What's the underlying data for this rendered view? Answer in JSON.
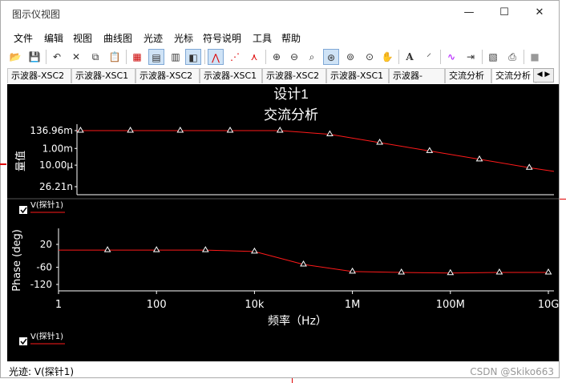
{
  "window": {
    "title": "图示仪视图",
    "controls": [
      "—",
      "☐",
      "✕"
    ]
  },
  "menu": [
    "文件",
    "编辑",
    "视图",
    "曲线图",
    "光迹",
    "光标",
    "符号说明",
    "工具",
    "帮助"
  ],
  "toolbar": {
    "icons": [
      "open-icon",
      "save-icon",
      "undo-icon",
      "cut-icon",
      "copy-icon",
      "paste-icon",
      "grid-icon",
      "legend-icon",
      "bar-icon",
      "overlay-icon",
      "line-icon",
      "dots-icon",
      "line-dots-icon",
      "zoom-in-icon",
      "zoom-out-icon",
      "zoom-fit-icon",
      "zoom-x-icon",
      "zoom-y-icon",
      "zoom-xy-icon",
      "pan-icon",
      "text-icon",
      "marker-icon",
      "trace-icon",
      "export-icon",
      "copy-graph-icon",
      "print-icon",
      "stop-icon"
    ],
    "text_button": "A"
  },
  "tabs": [
    "示波器-XSC2",
    "示波器-XSC1",
    "示波器-XSC2",
    "示波器-XSC1",
    "示波器-XSC2",
    "示波器-XSC1",
    "示波器-XSC2",
    "交流分析",
    "交流分析"
  ],
  "chart": {
    "title": "设计1",
    "subtitle": "交流分析",
    "xlabel": "频率（Hz）",
    "legend_text": "V(探针1)",
    "accent": "#ff1a1a"
  },
  "chart_data": [
    {
      "type": "line",
      "title": "设计1",
      "ylabel": "量值",
      "yscale": "log",
      "yticks": [
        "136.96m",
        "1.00m",
        "10.00μ",
        "26.21n"
      ],
      "ytick_values": [
        0.13696,
        0.001,
        1e-05,
        2.621e-08
      ],
      "xscale": "log",
      "xlim": [
        1,
        10000000000
      ],
      "series": [
        {
          "name": "V(探针1)",
          "x": [
            3.2,
            32,
            320,
            3200,
            32000,
            320000,
            3200000,
            32000000,
            320000000,
            3200000000
          ],
          "values": [
            0.137,
            0.137,
            0.137,
            0.137,
            0.137,
            0.05,
            0.005,
            0.0005,
            5e-05,
            5e-06
          ]
        }
      ]
    },
    {
      "type": "line",
      "ylabel": "Phase (deg)",
      "ylim": [
        -140,
        40
      ],
      "yticks": [
        "20",
        "-60",
        "-120"
      ],
      "ytick_values": [
        20,
        -60,
        -120
      ],
      "xscale": "log",
      "xlim": [
        1,
        10000000000
      ],
      "xticks": [
        "1",
        "100",
        "10k",
        "1M",
        "100M",
        "10G"
      ],
      "xtick_values": [
        1,
        100,
        10000,
        1000000,
        100000000,
        10000000000
      ],
      "series": [
        {
          "name": "V(探针1)",
          "x": [
            1,
            10,
            100,
            1000,
            10000,
            100000,
            1000000,
            10000000,
            100000000,
            1000000000,
            10000000000
          ],
          "values": [
            0,
            0,
            0,
            0,
            -5,
            -50,
            -75,
            -78,
            -80,
            -78,
            -78
          ]
        }
      ]
    }
  ],
  "status": {
    "text": "光迹: V(探针1)",
    "watermark": "CSDN @Skiko663"
  }
}
